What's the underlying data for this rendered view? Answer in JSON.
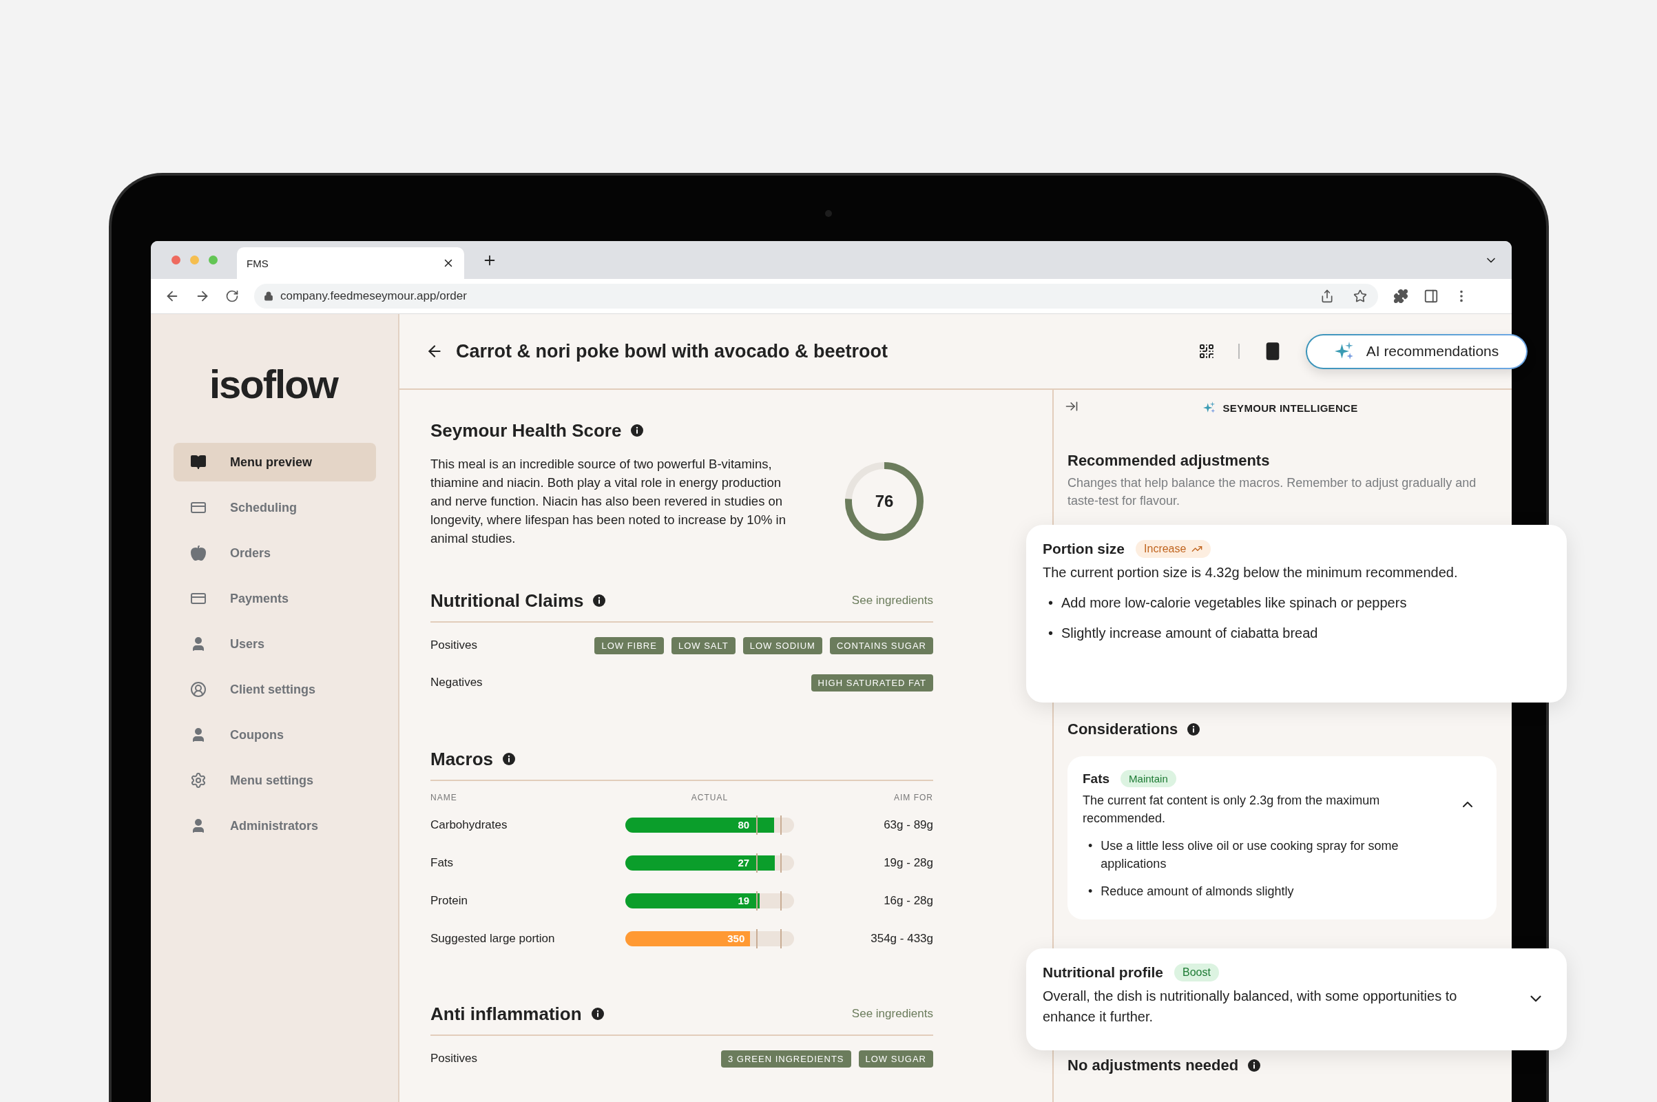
{
  "browser": {
    "tab_title": "FMS",
    "url": "company.feedmeseymour.app/order"
  },
  "sidebar": {
    "logo": "isoflow",
    "items": [
      {
        "label": "Menu preview",
        "kind": "book",
        "selected": true
      },
      {
        "label": "Scheduling",
        "kind": "card",
        "selected": false
      },
      {
        "label": "Orders",
        "kind": "apple",
        "selected": false
      },
      {
        "label": "Payments",
        "kind": "card",
        "selected": false
      },
      {
        "label": "Users",
        "kind": "user",
        "selected": false
      },
      {
        "label": "Client settings",
        "kind": "user-circle",
        "selected": false
      },
      {
        "label": "Coupons",
        "kind": "user",
        "selected": false
      },
      {
        "label": "Menu settings",
        "kind": "gear",
        "selected": false
      },
      {
        "label": "Administrators",
        "kind": "user",
        "selected": false
      }
    ]
  },
  "header": {
    "title": "Carrot & nori poke bowl with avocado & beetroot",
    "ai_button": "AI recommendations"
  },
  "health_score": {
    "title": "Seymour Health Score",
    "text": "This meal is an incredible source of two powerful B-vitamins, thiamine and niacin. Both play a vital role in energy production and nerve function. Niacin has also been revered in studies on longevity, where lifespan has been noted to increase by 10% in animal studies.",
    "score": "76",
    "level": 0.76
  },
  "nutritional_claims": {
    "title": "Nutritional Claims",
    "link": "See ingredients",
    "rows": [
      {
        "label": "Positives",
        "tags": [
          "LOW FIBRE",
          "LOW SALT",
          "LOW SODIUM",
          "CONTAINS SUGAR"
        ]
      },
      {
        "label": "Negatives",
        "tags": [
          "HIGH SATURATED FAT"
        ]
      }
    ]
  },
  "macros": {
    "title": "Macros",
    "columns": [
      "NAME",
      "ACTUAL",
      "AIM FOR"
    ],
    "rows": [
      {
        "name": "Carbohydrates",
        "value": "80",
        "level": 0.88,
        "color": "#0b9e2b",
        "aim": "63g - 89g"
      },
      {
        "name": "Fats",
        "value": "27",
        "level": 0.885,
        "color": "#0b9e2b",
        "aim": "19g - 28g"
      },
      {
        "name": "Protein",
        "value": "19",
        "level": 0.795,
        "color": "#0b9e2b",
        "aim": "16g - 28g"
      },
      {
        "name": "Suggested large portion",
        "value": "350",
        "level": 0.74,
        "color": "#ff9933",
        "aim": "354g - 433g"
      }
    ]
  },
  "anti_inflammation": {
    "title": "Anti inflammation",
    "link": "See ingredients",
    "rows": [
      {
        "label": "Positives",
        "tags": [
          "3 GREEN INGREDIENTS",
          "LOW SUGAR"
        ]
      }
    ]
  },
  "ai_panel": {
    "title": "SEYMOUR INTELLIGENCE",
    "heading": "Recommended adjustments",
    "description": "Changes that help balance the macros. Remember to adjust gradually and taste-test for flavour.",
    "considerations_title": "Considerations",
    "considerations": [
      {
        "title": "Fats",
        "badge": {
          "label": "Maintain",
          "kind": "positive"
        },
        "text": "The current fat content is only 2.3g from the maximum recommended.",
        "bullet_marker": "•",
        "bullets": [
          "Use a little less olive oil or use cooking spray for some applications",
          "Reduce amount of almonds slightly"
        ],
        "expanded": true
      }
    ],
    "no_adjustments_title": "No adjustments needed"
  },
  "floating_cards": [
    {
      "title": "Portion size",
      "badge": {
        "label": "Increase",
        "kind": "increase"
      },
      "text": "The current portion size is 4.32g below the minimum recommended.",
      "bullet_marker": "•",
      "bullets": [
        "Add more low-calorie vegetables like spinach or peppers",
        "Slightly increase amount of ciabatta bread"
      ]
    },
    {
      "title": "Nutritional profile",
      "badge": {
        "label": "Boost",
        "kind": "positive"
      },
      "text": "Overall, the dish is nutritionally balanced, with some opportunities to enhance it further.",
      "expanded": false
    }
  ]
}
